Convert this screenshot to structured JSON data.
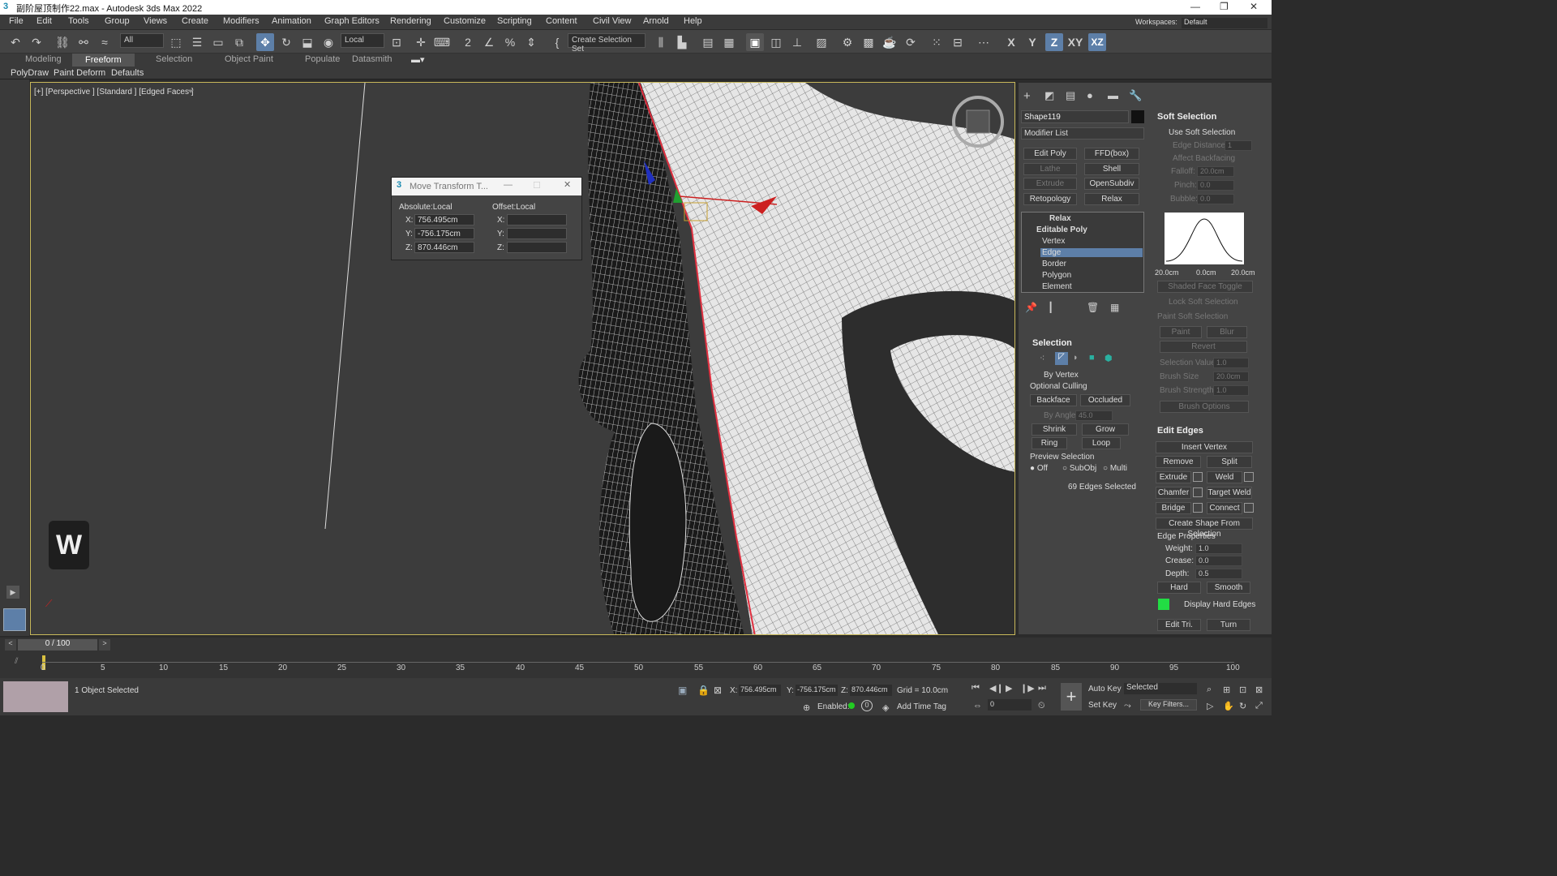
{
  "window": {
    "title": "副阶屋顶制作22.max - Autodesk 3ds Max 2022"
  },
  "menu": [
    "File",
    "Edit",
    "Tools",
    "Group",
    "Views",
    "Create",
    "Modifiers",
    "Animation",
    "Graph Editors",
    "Rendering",
    "Customize",
    "Scripting",
    "Content",
    "Civil View",
    "Arnold",
    "Help"
  ],
  "workspaces": {
    "label": "Workspaces:",
    "value": "Default"
  },
  "toolbar": {
    "filter": "All",
    "coord": "Local",
    "selection_set": "Create Selection Set",
    "axis_x": "X",
    "axis_y": "Y",
    "axis_z": "Z",
    "axis_xy": "XY",
    "axis_xz": "XZ"
  },
  "ribbon": {
    "tabs": [
      "Modeling",
      "Freeform",
      "Selection",
      "Object Paint",
      "Populate",
      "Datasmith"
    ],
    "active": "Freeform",
    "subtabs": [
      "PolyDraw",
      "Paint Deform",
      "Defaults"
    ]
  },
  "viewport": {
    "label": "[+] [Perspective ] [Standard ] [Edged Faces ]",
    "key": "W"
  },
  "move_dialog": {
    "title": "Move Transform T...",
    "absolute": "Absolute:Local",
    "offset": "Offset:Local",
    "x": "756.495cm",
    "y": "-756.175cm",
    "z": "870.446cm",
    "lx": "X:",
    "ly": "Y:",
    "lz": "Z:"
  },
  "command_panel": {
    "object_name": "Shape119",
    "modifier_list": "Modifier List",
    "buttons": [
      "Edit Poly",
      "FFD(box)",
      "Lathe",
      "Shell",
      "Extrude",
      "OpenSubdiv",
      "Retopology",
      "Relax"
    ],
    "stack": {
      "relax": "Relax",
      "editable_poly": "Editable Poly",
      "sub": [
        "Vertex",
        "Edge",
        "Border",
        "Polygon",
        "Element"
      ],
      "selected": "Edge"
    },
    "selection": {
      "title": "Selection",
      "by_vertex": "By Vertex",
      "optional_culling": "Optional Culling",
      "backface": "Backface",
      "occluded": "Occluded",
      "by_angle": "By Angle:",
      "by_angle_val": "45.0",
      "shrink": "Shrink",
      "grow": "Grow",
      "ring": "Ring",
      "loop": "Loop",
      "preview": "Preview Selection",
      "off": "Off",
      "subobj": "SubObj",
      "multi": "Multi",
      "status": "69 Edges Selected"
    },
    "soft_selection": {
      "title": "Soft Selection",
      "use": "Use Soft Selection",
      "edge_distance": "Edge Distance:",
      "edge_distance_val": "1",
      "affect_backfacing": "Affect Backfacing",
      "falloff": "Falloff:",
      "falloff_val": "20.0cm",
      "pinch": "Pinch:",
      "pinch_val": "0.0",
      "bubble": "Bubble:",
      "bubble_val": "0.0",
      "curve_left": "20.0cm",
      "curve_mid": "0.0cm",
      "curve_right": "20.0cm",
      "shaded_face_toggle": "Shaded Face Toggle",
      "lock": "Lock Soft Selection",
      "paint_soft": "Paint Soft Selection",
      "paint": "Paint",
      "blur": "Blur",
      "revert": "Revert",
      "selection_value": "Selection Value",
      "selection_value_val": "1.0",
      "brush_size": "Brush Size",
      "brush_size_val": "20.0cm",
      "brush_strength": "Brush Strength",
      "brush_strength_val": "1.0",
      "brush_options": "Brush Options"
    },
    "edit_edges": {
      "title": "Edit Edges",
      "insert_vertex": "Insert Vertex",
      "remove": "Remove",
      "split": "Split",
      "extrude": "Extrude",
      "weld": "Weld",
      "chamfer": "Chamfer",
      "target_weld": "Target Weld",
      "bridge": "Bridge",
      "connect": "Connect",
      "create_shape": "Create Shape From Selection",
      "edge_properties": "Edge Properties",
      "weight": "Weight:",
      "weight_val": "1.0",
      "crease": "Crease:",
      "crease_val": "0.0",
      "depth": "Depth:",
      "depth_val": "0.5",
      "hard": "Hard",
      "smooth": "Smooth",
      "display_hard_edges": "Display Hard Edges",
      "edit_tri": "Edit Tri.",
      "turn": "Turn"
    }
  },
  "timeline": {
    "frame": "0 / 100",
    "ticks": [
      "0",
      "5",
      "10",
      "15",
      "20",
      "25",
      "30",
      "35",
      "40",
      "45",
      "50",
      "55",
      "60",
      "65",
      "70",
      "75",
      "80",
      "85",
      "90",
      "95",
      "100"
    ]
  },
  "status": {
    "selected": "1 Object Selected",
    "x": "756.495cm",
    "y": "-756.175cm",
    "z": "870.446cm",
    "grid": "Grid = 10.0cm",
    "enabled": "Enabled:",
    "add_time_tag": "Add Time Tag",
    "auto_key": "Auto Key",
    "set_key": "Set Key",
    "selected_dd": "Selected",
    "key_filters": "Key Filters...",
    "frame_val": "0"
  },
  "colors": {
    "accent": "#5d7fa8",
    "viewport_border": "#c8b85a",
    "selection_edge": "#e03040",
    "mesh_face": "#e8e8e8",
    "hard_edges_swatch": "#22dd44"
  }
}
